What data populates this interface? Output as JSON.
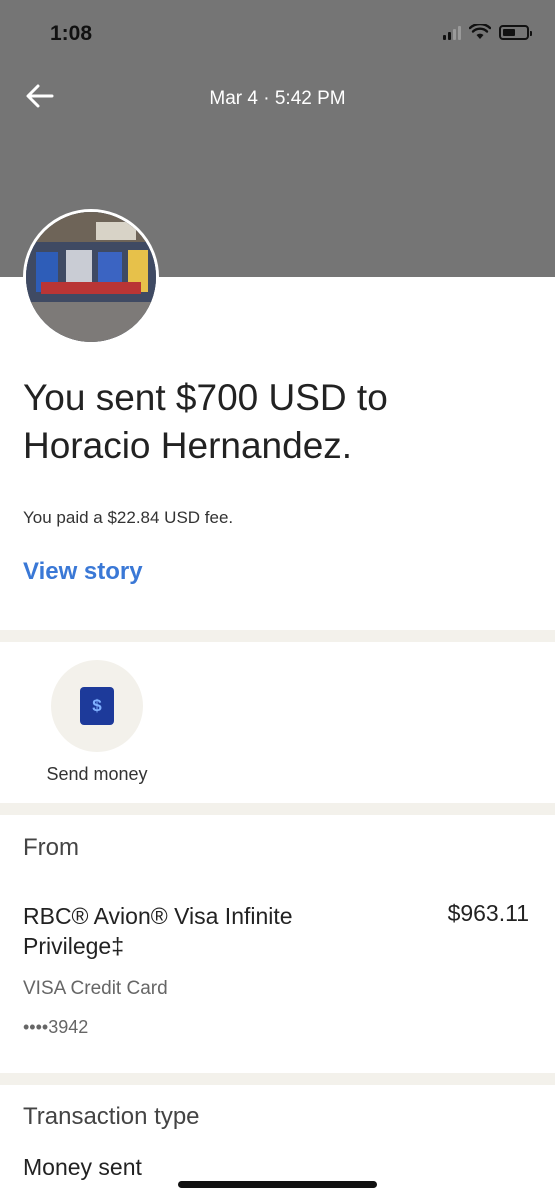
{
  "status_bar": {
    "time": "1:08"
  },
  "header": {
    "title": "Mar 4 · 5:42 PM"
  },
  "transaction": {
    "headline": "You sent $700 USD to Horacio Hernandez.",
    "fee_text": "You paid a $22.84 USD fee.",
    "view_story_label": "View story"
  },
  "actions": [
    {
      "label": "Send money",
      "icon": "dollar-icon",
      "glyph": "$"
    }
  ],
  "from": {
    "title": "From",
    "account_name": "RBC® Avion® Visa Infinite Privilege‡",
    "amount": "$963.11",
    "card_type": "VISA Credit Card",
    "card_number": "••••3942"
  },
  "transaction_type": {
    "title": "Transaction type",
    "value": "Money sent"
  },
  "colors": {
    "header_bg": "#757575",
    "link": "#3a78d6",
    "divider": "#f3f1eb",
    "send_money_tile": "#1d3a9a"
  }
}
